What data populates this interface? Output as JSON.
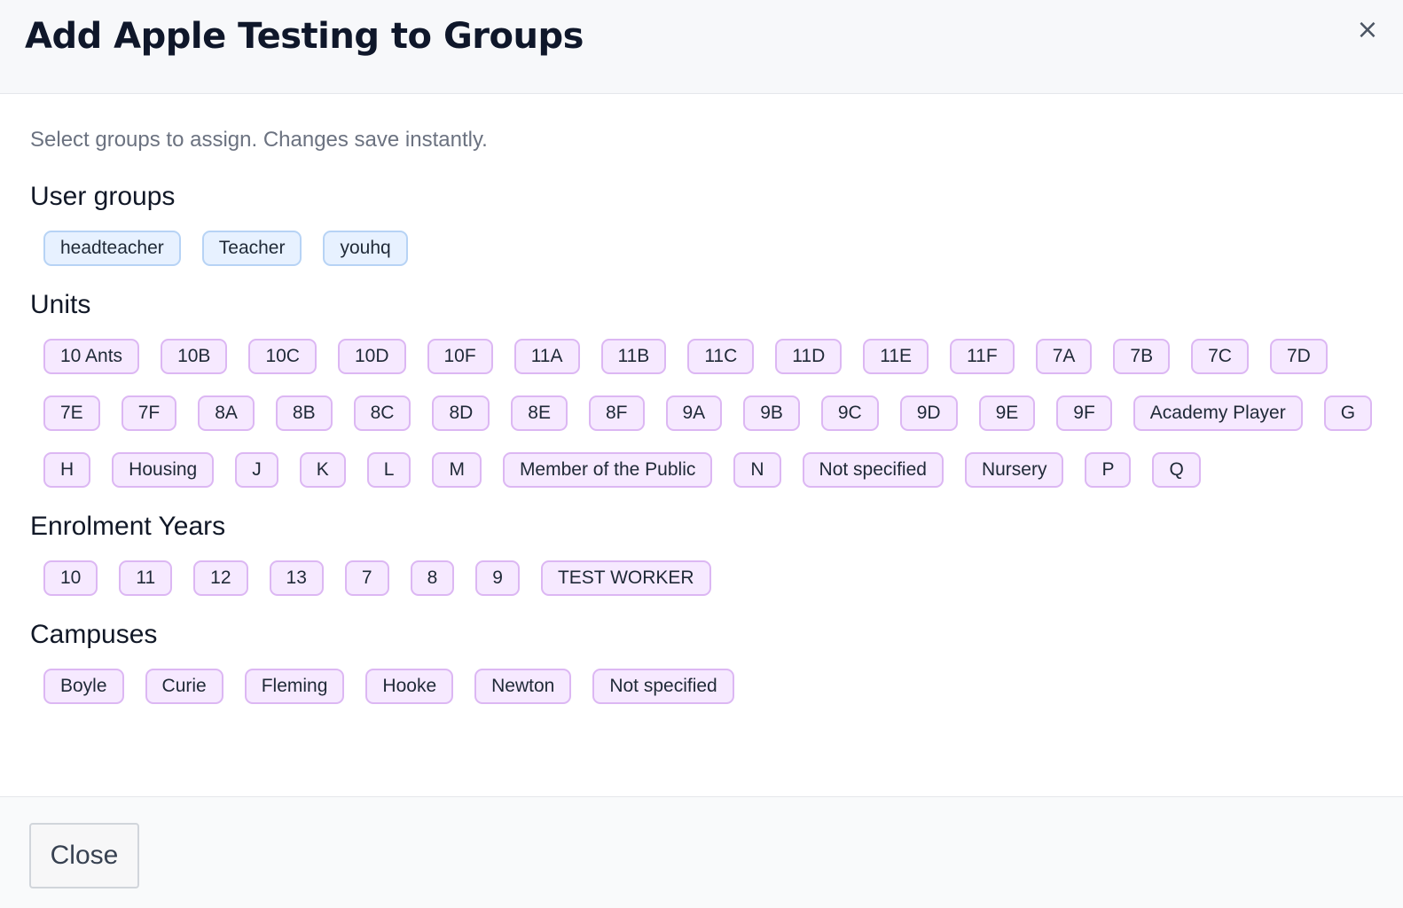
{
  "header": {
    "title": "Add Apple Testing to Groups",
    "close_icon": "×"
  },
  "instructions": "Select groups to assign. Changes save instantly.",
  "sections": [
    {
      "title": "User groups",
      "style": "user",
      "chips": [
        "headteacher",
        "Teacher",
        "youhq"
      ]
    },
    {
      "title": "Units",
      "style": "other",
      "chips": [
        "10 Ants",
        "10B",
        "10C",
        "10D",
        "10F",
        "11A",
        "11B",
        "11C",
        "11D",
        "11E",
        "11F",
        "7A",
        "7B",
        "7C",
        "7D",
        "7E",
        "7F",
        "8A",
        "8B",
        "8C",
        "8D",
        "8E",
        "8F",
        "9A",
        "9B",
        "9C",
        "9D",
        "9E",
        "9F",
        "Academy Player",
        "G",
        "H",
        "Housing",
        "J",
        "K",
        "L",
        "M",
        "Member of the Public",
        "N",
        "Not specified",
        "Nursery",
        "P",
        "Q"
      ]
    },
    {
      "title": "Enrolment Years",
      "style": "other",
      "chips": [
        "10",
        "11",
        "12",
        "13",
        "7",
        "8",
        "9",
        "TEST WORKER"
      ]
    },
    {
      "title": "Campuses",
      "style": "other",
      "chips": [
        "Boyle",
        "Curie",
        "Fleming",
        "Hooke",
        "Newton",
        "Not specified"
      ]
    }
  ],
  "footer": {
    "close_label": "Close"
  },
  "colors": {
    "user_chip_bg": "#e7f1ff",
    "user_chip_border": "#b7d3f5",
    "other_chip_bg": "#f6e9ff",
    "other_chip_border": "#dcb7f3"
  }
}
